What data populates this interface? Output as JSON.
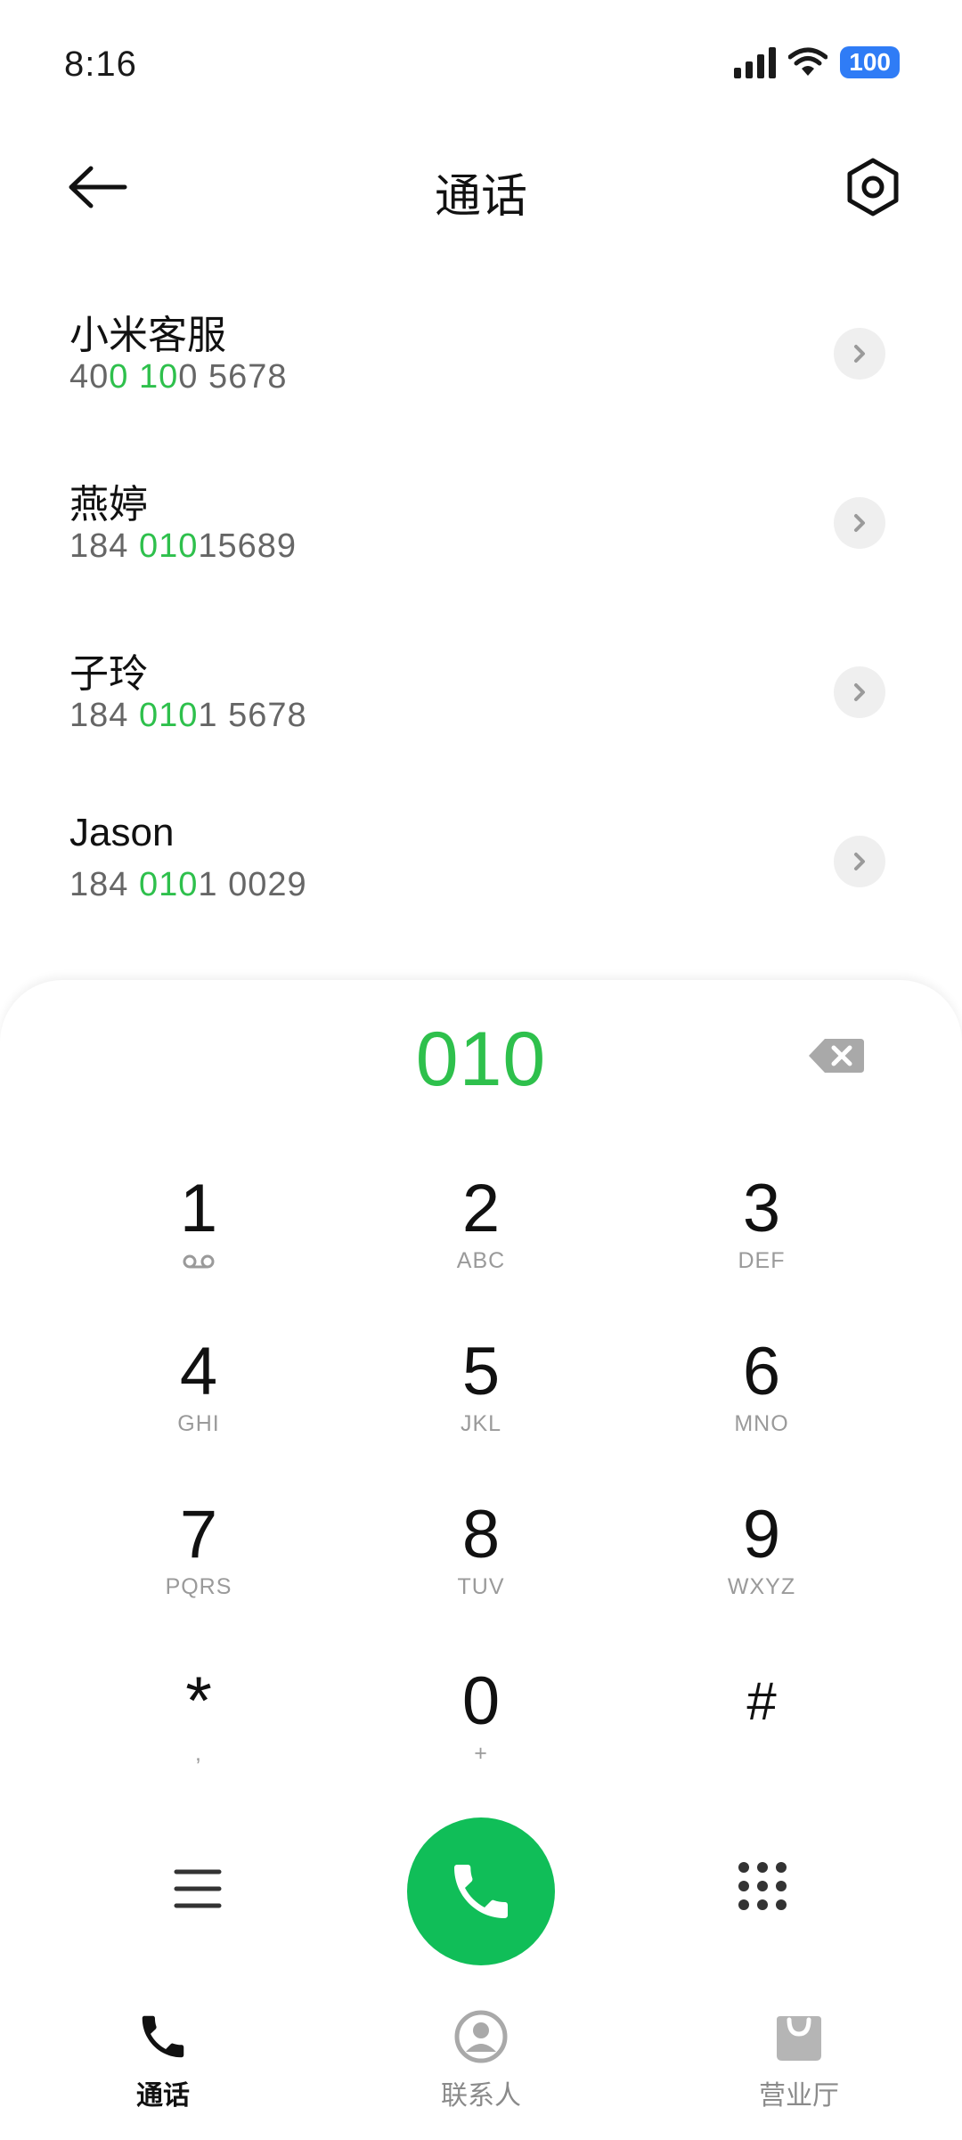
{
  "status_bar": {
    "time": "8:16",
    "battery": "100"
  },
  "header": {
    "title": "通话"
  },
  "contacts": [
    {
      "name": "小米客服",
      "number_parts": [
        {
          "t": "40",
          "hl": false
        },
        {
          "t": "0",
          "hl": true
        },
        {
          "t": " ",
          "hl": false
        },
        {
          "t": "10",
          "hl": true
        },
        {
          "t": "0 5678",
          "hl": false
        }
      ]
    },
    {
      "name": "燕婷",
      "number_parts": [
        {
          "t": "184 ",
          "hl": false
        },
        {
          "t": "010",
          "hl": true
        },
        {
          "t": "15689",
          "hl": false
        }
      ]
    },
    {
      "name": "子玲",
      "number_parts": [
        {
          "t": "184 ",
          "hl": false
        },
        {
          "t": "010",
          "hl": true
        },
        {
          "t": "1 5678",
          "hl": false
        }
      ]
    },
    {
      "name": "Jason",
      "number_parts": [
        {
          "t": "184 ",
          "hl": false
        },
        {
          "t": "010",
          "hl": true
        },
        {
          "t": "1 0029",
          "hl": false
        }
      ]
    }
  ],
  "dialpad": {
    "display": "010",
    "keys": [
      {
        "digit": "1",
        "letters": ""
      },
      {
        "digit": "2",
        "letters": "ABC"
      },
      {
        "digit": "3",
        "letters": "DEF"
      },
      {
        "digit": "4",
        "letters": "GHI"
      },
      {
        "digit": "5",
        "letters": "JKL"
      },
      {
        "digit": "6",
        "letters": "MNO"
      },
      {
        "digit": "7",
        "letters": "PQRS"
      },
      {
        "digit": "8",
        "letters": "TUV"
      },
      {
        "digit": "9",
        "letters": "WXYZ"
      },
      {
        "digit": "*",
        "letters": ","
      },
      {
        "digit": "0",
        "letters": "+"
      },
      {
        "digit": "#",
        "letters": ""
      }
    ]
  },
  "tabs": [
    {
      "label": "通话",
      "icon": "phone-icon",
      "active": true
    },
    {
      "label": "联系人",
      "icon": "contacts-icon",
      "active": false
    },
    {
      "label": "营业厅",
      "icon": "shopping-bag-icon",
      "active": false
    }
  ],
  "colors": {
    "accent_green": "#2ec04c",
    "call_button": "#10be58",
    "battery_blue": "#2f7cf6"
  }
}
